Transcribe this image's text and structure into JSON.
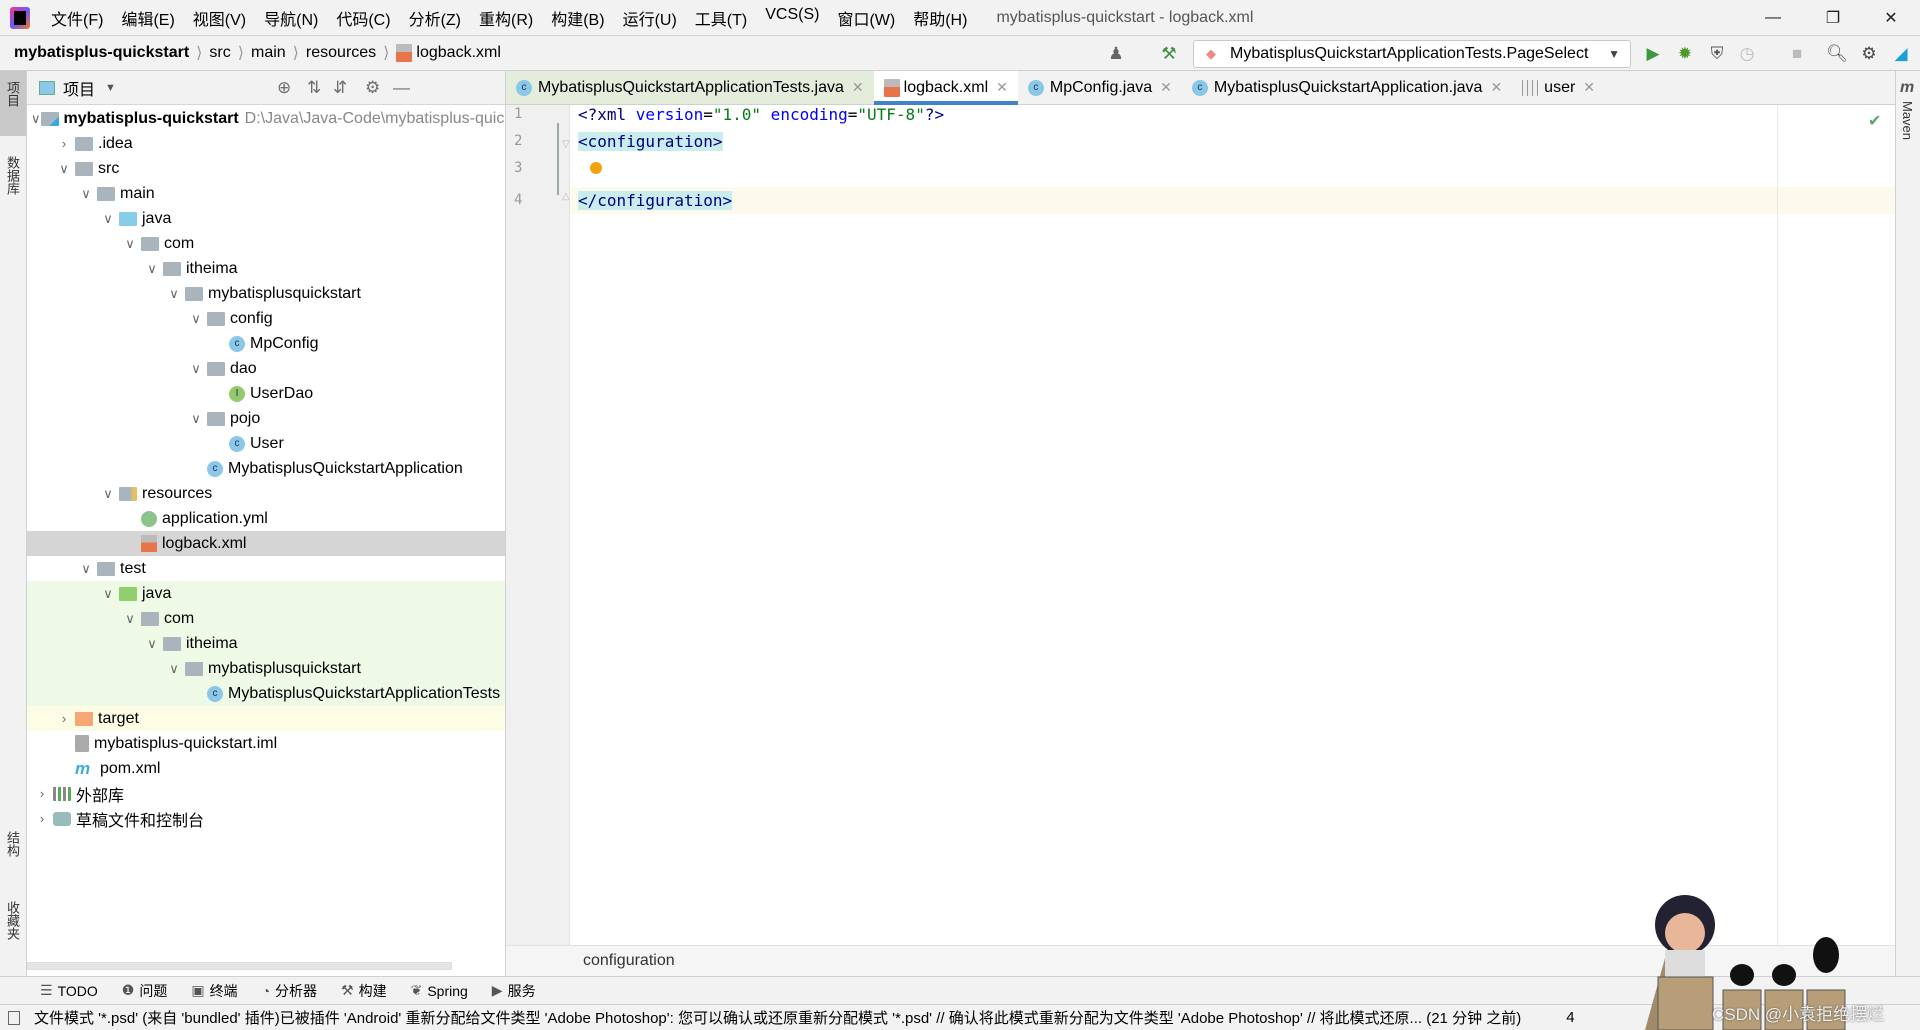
{
  "menubar": {
    "items": [
      "文件(F)",
      "编辑(E)",
      "视图(V)",
      "导航(N)",
      "代码(C)",
      "分析(Z)",
      "重构(R)",
      "构建(B)",
      "运行(U)",
      "工具(T)",
      "VCS(S)",
      "窗口(W)",
      "帮助(H)"
    ],
    "title": "mybatisplus-quickstart - logback.xml"
  },
  "breadcrumb": [
    "mybatisplus-quickstart",
    "src",
    "main",
    "resources",
    "logback.xml"
  ],
  "run_config": "MybatisplusQuickstartApplicationTests.PageSelect",
  "left_stripe": {
    "project": "项目",
    "database": "数据库",
    "structure": "结构",
    "favorites": "收藏夹"
  },
  "right_stripe": {
    "maven": "Maven"
  },
  "project_panel": {
    "title": "项目"
  },
  "tree": [
    {
      "label": "mybatisplus-quickstart",
      "hint": "D:\\Java\\Java-Code\\mybatisplus-quickstart",
      "level": 0,
      "icon": "module-folder",
      "expanded": true,
      "bold": true
    },
    {
      "label": ".idea",
      "level": 1,
      "icon": "folder",
      "expanded": false
    },
    {
      "label": "src",
      "level": 1,
      "icon": "folder",
      "expanded": true
    },
    {
      "label": "main",
      "level": 2,
      "icon": "folder",
      "expanded": true
    },
    {
      "label": "java",
      "level": 3,
      "icon": "source-folder",
      "expanded": true
    },
    {
      "label": "com",
      "level": 4,
      "icon": "package",
      "expanded": true
    },
    {
      "label": "itheima",
      "level": 5,
      "icon": "package",
      "expanded": true
    },
    {
      "label": "mybatisplusquickstart",
      "level": 6,
      "icon": "package",
      "expanded": true
    },
    {
      "label": "config",
      "level": 7,
      "icon": "package",
      "expanded": true
    },
    {
      "label": "MpConfig",
      "level": 8,
      "icon": "class"
    },
    {
      "label": "dao",
      "level": 7,
      "icon": "package",
      "expanded": true
    },
    {
      "label": "UserDao",
      "level": 8,
      "icon": "interface"
    },
    {
      "label": "pojo",
      "level": 7,
      "icon": "package",
      "expanded": true
    },
    {
      "label": "User",
      "level": 8,
      "icon": "class"
    },
    {
      "label": "MybatisplusQuickstartApplication",
      "level": 7,
      "icon": "spring-class"
    },
    {
      "label": "resources",
      "level": 3,
      "icon": "resources-folder",
      "expanded": true
    },
    {
      "label": "application.yml",
      "level": 4,
      "icon": "yml"
    },
    {
      "label": "logback.xml",
      "level": 4,
      "icon": "xml",
      "selected": true
    },
    {
      "label": "test",
      "level": 2,
      "icon": "folder",
      "expanded": true
    },
    {
      "label": "java",
      "level": 3,
      "icon": "test-folder",
      "expanded": true,
      "green": true
    },
    {
      "label": "com",
      "level": 4,
      "icon": "package",
      "expanded": true,
      "green": true
    },
    {
      "label": "itheima",
      "level": 5,
      "icon": "package",
      "expanded": true,
      "green": true
    },
    {
      "label": "mybatisplusquickstart",
      "level": 6,
      "icon": "package",
      "expanded": true,
      "green": true
    },
    {
      "label": "MybatisplusQuickstartApplicationTests",
      "level": 7,
      "icon": "test-class",
      "green": true
    },
    {
      "label": "target",
      "level": 1,
      "icon": "target-folder",
      "expanded": false,
      "yellow": true
    },
    {
      "label": "mybatisplus-quickstart.iml",
      "level": 1,
      "icon": "iml"
    },
    {
      "label": "pom.xml",
      "level": 1,
      "icon": "maven"
    },
    {
      "label": "外部库",
      "level": 0,
      "icon": "library",
      "expanded": false
    },
    {
      "label": "草稿文件和控制台",
      "level": 0,
      "icon": "scratch",
      "expanded": false
    }
  ],
  "tabs": [
    {
      "label": "MybatisplusQuickstartApplicationTests.java",
      "icon": "test-class"
    },
    {
      "label": "logback.xml",
      "icon": "xml",
      "active": true
    },
    {
      "label": "MpConfig.java",
      "icon": "class"
    },
    {
      "label": "MybatisplusQuickstartApplication.java",
      "icon": "spring-class"
    },
    {
      "label": "user",
      "icon": "table"
    }
  ],
  "editor": {
    "line_numbers": [
      "1",
      "2",
      "3",
      "4"
    ],
    "line1": {
      "pi_open": "<?xml ",
      "a1": "version",
      "eq1": "=",
      "v1": "\"1.0\"",
      "a2": " encoding",
      "eq2": "=",
      "v2": "\"UTF-8\"",
      "pi_close": "?>"
    },
    "line2": "<configuration>",
    "line4": "</configuration>",
    "breadcrumb": "configuration"
  },
  "tool_windows": [
    {
      "label": "TODO",
      "icon": "list-icon"
    },
    {
      "label": "问题",
      "icon": "problems-icon"
    },
    {
      "label": "终端",
      "icon": "terminal-icon"
    },
    {
      "label": "分析器",
      "icon": "profiler-icon"
    },
    {
      "label": "构建",
      "icon": "hammer-icon"
    },
    {
      "label": "Spring",
      "icon": "spring-icon"
    },
    {
      "label": "服务",
      "icon": "services-icon"
    }
  ],
  "status": "文件模式 '*.psd' (来自 'bundled' 插件)已被插件 'Android' 重新分配给文件类型 'Adobe Photoshop': 您可以确认或还原重新分配模式 '*.psd' // 确认将此模式重新分配为文件类型 'Adobe Photoshop' // 将此模式还原... (21 分钟 之前)",
  "status_extra": "4",
  "watermark": "CSDN @小袁拒绝摆烂",
  "colors": {
    "accent": "#4083c9",
    "tag_highlight": "#c9ecec",
    "selection": "#d5d5d5",
    "test_bg": "#eefae6"
  }
}
